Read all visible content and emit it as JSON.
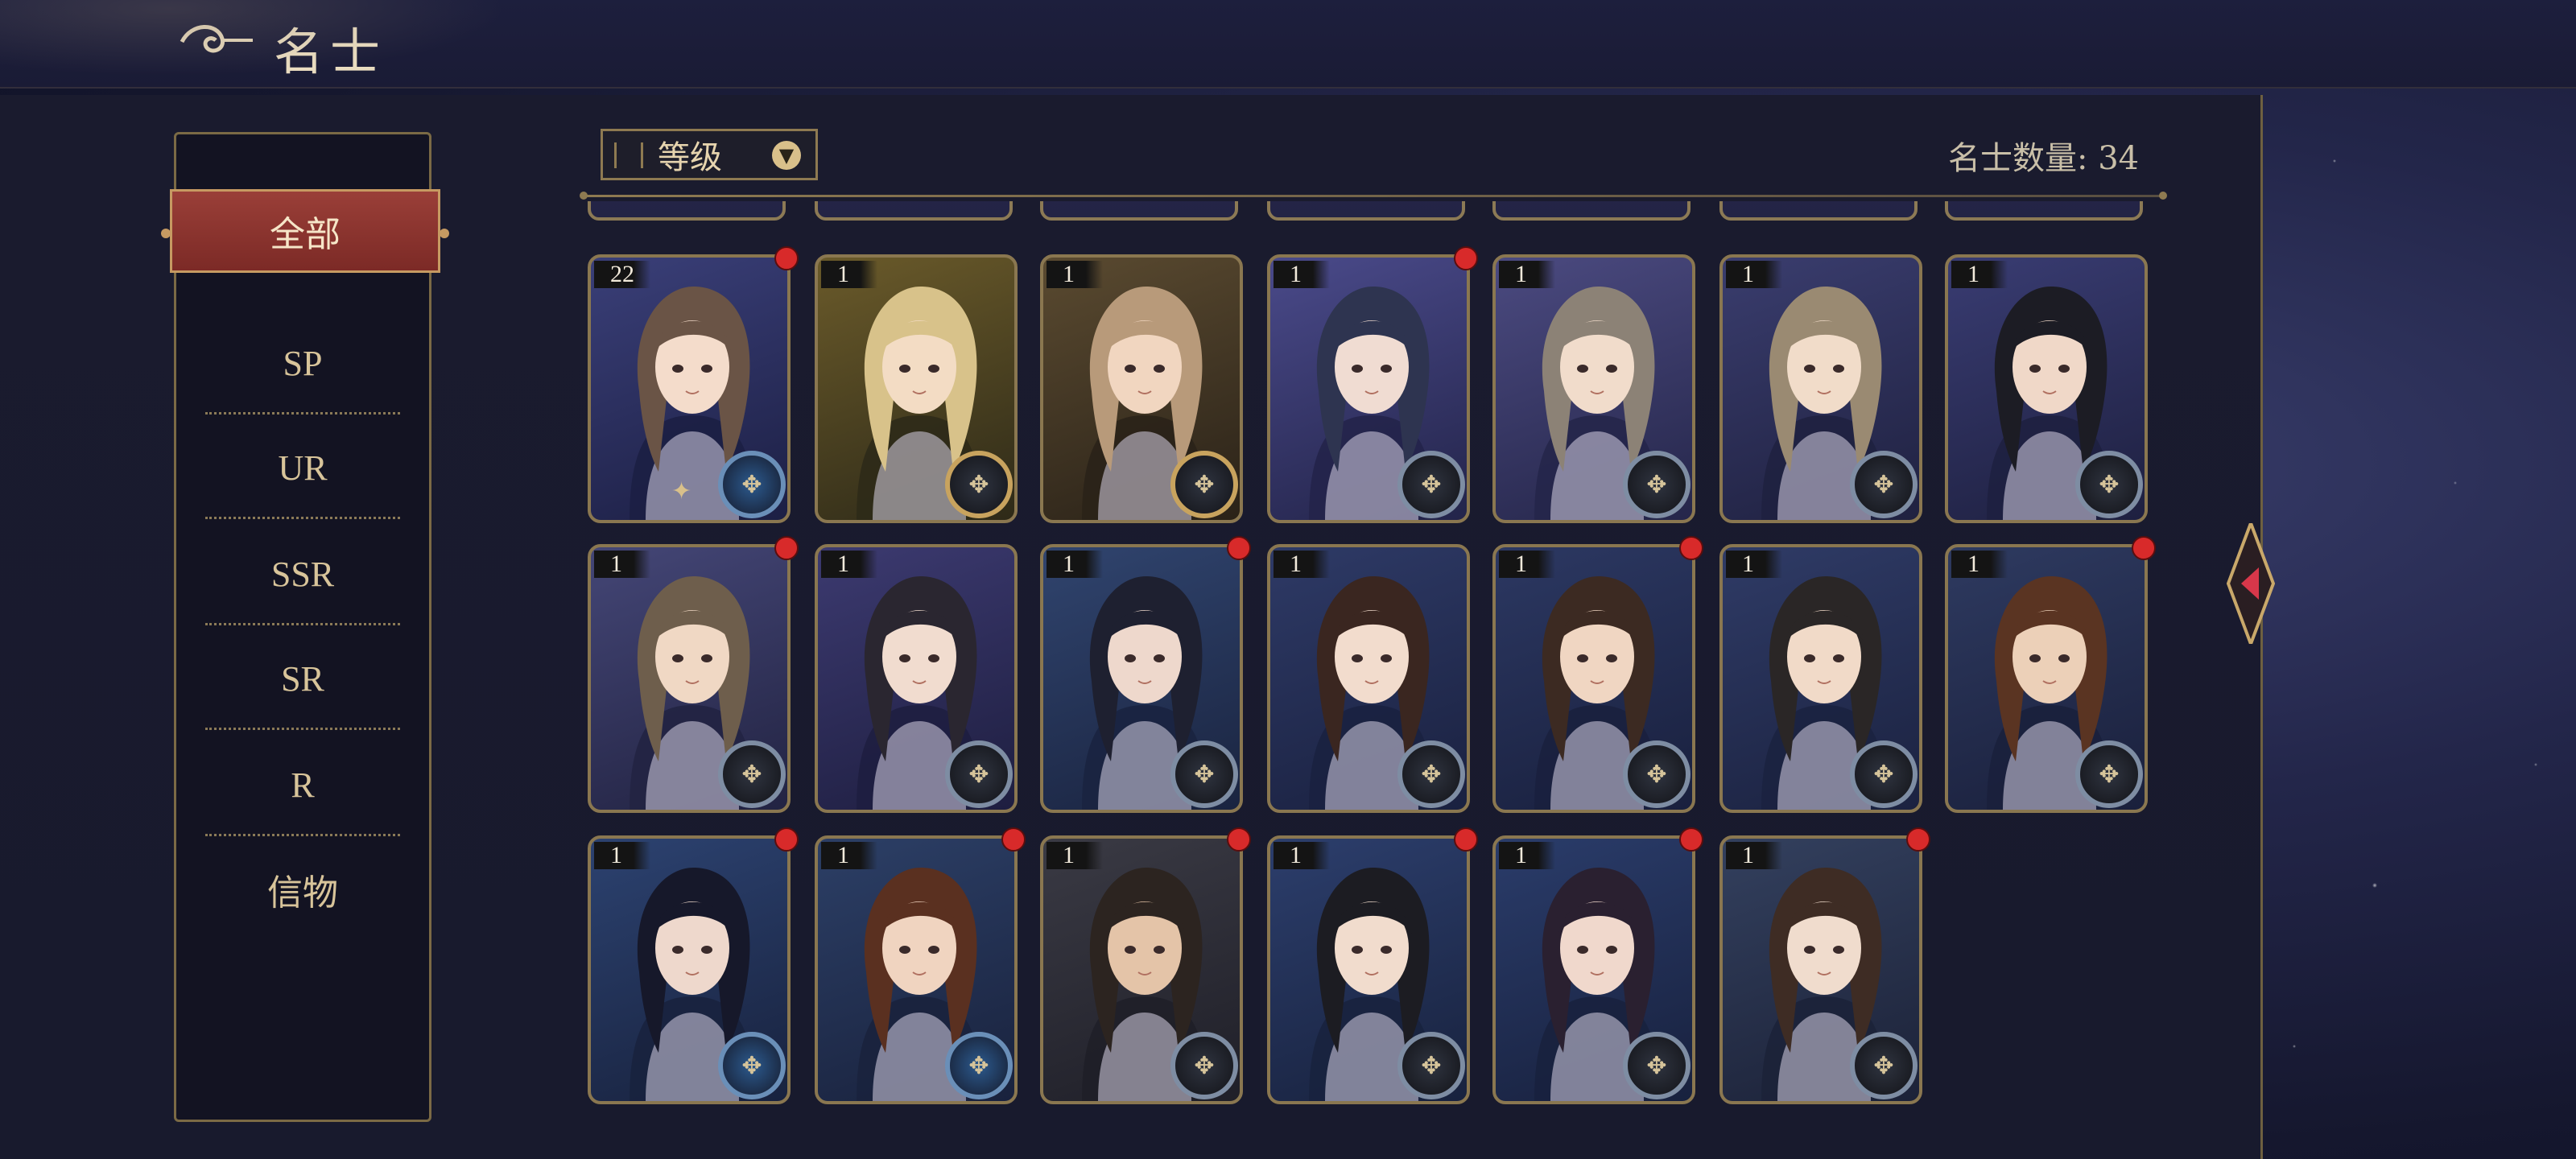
{
  "header": {
    "title": "名士"
  },
  "sidebar": {
    "items": [
      {
        "label": "全部",
        "active": true
      },
      {
        "label": "SP",
        "active": false
      },
      {
        "label": "UR",
        "active": false
      },
      {
        "label": "SSR",
        "active": false
      },
      {
        "label": "SR",
        "active": false
      },
      {
        "label": "R",
        "active": false
      },
      {
        "label": "信物",
        "active": false
      }
    ]
  },
  "filter": {
    "selected": "等级"
  },
  "count": {
    "text": "名士数量: 34"
  },
  "colors": {
    "accent_gold": "#8a7750",
    "active_tab": "#8e3530",
    "notify_red": "#d82a2a"
  },
  "cards": [
    {
      "level": "22",
      "badge": true,
      "medal": "blue",
      "hair": "#6a5446",
      "skin": "#f4dccb",
      "bg1": "#3a3f78",
      "bg2": "#1c1f44",
      "sparkle": true
    },
    {
      "level": "1",
      "badge": false,
      "medal": "gold",
      "hair": "#d8c28a",
      "skin": "#f3dcc4",
      "bg1": "#6a5a2a",
      "bg2": "#2e2a18",
      "sparkle": false
    },
    {
      "level": "1",
      "badge": false,
      "medal": "gold",
      "hair": "#b89a7a",
      "skin": "#f1d6c0",
      "bg1": "#5a4a30",
      "bg2": "#2a2218",
      "sparkle": false
    },
    {
      "level": "1",
      "badge": true,
      "medal": "silver",
      "hair": "#2e3450",
      "skin": "#f0dcd2",
      "bg1": "#4a4a8a",
      "bg2": "#23244a",
      "sparkle": false
    },
    {
      "level": "1",
      "badge": false,
      "medal": "silver",
      "hair": "#8c8276",
      "skin": "#f1dccb",
      "bg1": "#4b4a80",
      "bg2": "#25264a",
      "sparkle": false
    },
    {
      "level": "1",
      "badge": false,
      "medal": "silver",
      "hair": "#9a8a72",
      "skin": "#f1dcc9",
      "bg1": "#3a3d6e",
      "bg2": "#1f2140",
      "sparkle": false
    },
    {
      "level": "1",
      "badge": false,
      "medal": "silver",
      "hair": "#1c1c24",
      "skin": "#f0d8c8",
      "bg1": "#393c72",
      "bg2": "#1e2040",
      "sparkle": false
    },
    {
      "level": "1",
      "badge": true,
      "medal": "silver",
      "hair": "#6e5e4c",
      "skin": "#f0d8c4",
      "bg1": "#444676",
      "bg2": "#222342",
      "sparkle": false
    },
    {
      "level": "1",
      "badge": false,
      "medal": "silver",
      "hair": "#2a2630",
      "skin": "#f1dccf",
      "bg1": "#3c3a70",
      "bg2": "#1e1e40",
      "sparkle": false
    },
    {
      "level": "1",
      "badge": true,
      "medal": "silver",
      "hair": "#1e2030",
      "skin": "#eed8cc",
      "bg1": "#30446e",
      "bg2": "#1a2440",
      "sparkle": false
    },
    {
      "level": "1",
      "badge": false,
      "medal": "silver",
      "hair": "#3a2620",
      "skin": "#f2dccd",
      "bg1": "#2e3a66",
      "bg2": "#1a2140",
      "sparkle": false
    },
    {
      "level": "1",
      "badge": true,
      "medal": "silver",
      "hair": "#3c2a22",
      "skin": "#f0d6c2",
      "bg1": "#2c3862",
      "bg2": "#19203e",
      "sparkle": false
    },
    {
      "level": "1",
      "badge": false,
      "medal": "silver",
      "hair": "#2a2626",
      "skin": "#f1dac8",
      "bg1": "#2f3b66",
      "bg2": "#1b2240",
      "sparkle": false
    },
    {
      "level": "1",
      "badge": true,
      "medal": "silver",
      "hair": "#5a3422",
      "skin": "#ecd0b8",
      "bg1": "#2e3a60",
      "bg2": "#1a203c",
      "sparkle": false
    },
    {
      "level": "1",
      "badge": true,
      "medal": "blue",
      "hair": "#16182a",
      "skin": "#eed8cc",
      "bg1": "#2c4270",
      "bg2": "#18223e",
      "sparkle": false
    },
    {
      "level": "1",
      "badge": true,
      "medal": "blue",
      "hair": "#5a3020",
      "skin": "#f0d4c0",
      "bg1": "#2c3f66",
      "bg2": "#19223d",
      "sparkle": false
    },
    {
      "level": "1",
      "badge": true,
      "medal": "silver",
      "hair": "#2c2420",
      "skin": "#e4c4a8",
      "bg1": "#3a3a44",
      "bg2": "#1f1f28",
      "sparkle": false
    },
    {
      "level": "1",
      "badge": true,
      "medal": "silver",
      "hair": "#1c1c22",
      "skin": "#f1dccd",
      "bg1": "#2c3e6c",
      "bg2": "#18223e",
      "sparkle": false
    },
    {
      "level": "1",
      "badge": true,
      "medal": "silver",
      "hair": "#2a2030",
      "skin": "#f0d8cc",
      "bg1": "#2a3c6a",
      "bg2": "#18213e",
      "sparkle": false
    },
    {
      "level": "1",
      "badge": true,
      "medal": "silver",
      "hair": "#3e2c24",
      "skin": "#f0dccd",
      "bg1": "#33405e",
      "bg2": "#1c2238",
      "sparkle": false
    }
  ]
}
